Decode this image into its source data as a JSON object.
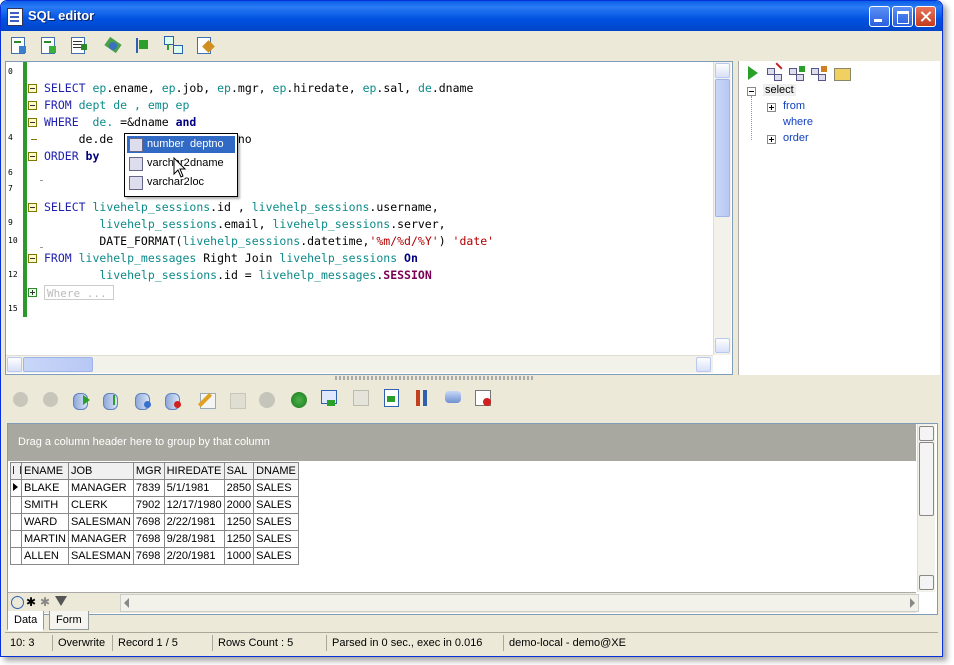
{
  "window": {
    "title": "SQL editor"
  },
  "toolbar": {
    "icons": [
      "sql-new-icon",
      "sql-open-icon",
      "sql-save-icon",
      "sql-execute-icon",
      "sql-step-icon",
      "sql-plan-icon",
      "sql-check-icon"
    ]
  },
  "editor": {
    "line_numbers": [
      "0",
      "4",
      "6",
      "7",
      "9",
      "10",
      "12",
      "15"
    ],
    "lines": [
      [
        {
          "t": "SELECT ",
          "c": "kwb"
        },
        {
          "t": "ep",
          "c": "id"
        },
        {
          "t": ".ename, ",
          "c": "plain"
        },
        {
          "t": "ep",
          "c": "id"
        },
        {
          "t": ".job, ",
          "c": "plain"
        },
        {
          "t": "ep",
          "c": "id"
        },
        {
          "t": ".mgr, ",
          "c": "plain"
        },
        {
          "t": "ep",
          "c": "id"
        },
        {
          "t": ".hiredate, ",
          "c": "plain"
        },
        {
          "t": "ep",
          "c": "id"
        },
        {
          "t": ".sal, ",
          "c": "plain"
        },
        {
          "t": "de",
          "c": "id"
        },
        {
          "t": ".dname",
          "c": "plain"
        }
      ],
      [
        {
          "t": "FROM ",
          "c": "kwb"
        },
        {
          "t": "dept de , emp ep",
          "c": "id"
        }
      ],
      [
        {
          "t": "WHERE ",
          "c": "kwb"
        },
        {
          "t": " de.",
          "c": "id"
        },
        {
          "t": " =&dname ",
          "c": "plain"
        },
        {
          "t": "and",
          "c": "kwd"
        }
      ],
      [
        {
          "t": "     de.de",
          "c": "plain"
        },
        {
          "t": "                  ",
          "c": "plain"
        },
        {
          "t": "no",
          "c": "plain"
        }
      ],
      [
        {
          "t": "ORDER ",
          "c": "kwb"
        },
        {
          "t": "by",
          "c": "kwd"
        }
      ],
      [
        {
          "t": "SELECT ",
          "c": "kwb"
        },
        {
          "t": "livehelp_sessions",
          "c": "id"
        },
        {
          "t": ".id , ",
          "c": "plain"
        },
        {
          "t": "livehelp_sessions",
          "c": "id"
        },
        {
          "t": ".username,",
          "c": "plain"
        }
      ],
      [
        {
          "t": "        livehelp_sessions",
          "c": "id"
        },
        {
          "t": ".email, ",
          "c": "plain"
        },
        {
          "t": "livehelp_sessions",
          "c": "id"
        },
        {
          "t": ".server,",
          "c": "plain"
        }
      ],
      [
        {
          "t": "        DATE_FORMAT(",
          "c": "plain"
        },
        {
          "t": "livehelp_sessions",
          "c": "id"
        },
        {
          "t": ".datetime,",
          "c": "plain"
        },
        {
          "t": "'%m/%d/%Y'",
          "c": "str"
        },
        {
          "t": ") ",
          "c": "plain"
        },
        {
          "t": "'date'",
          "c": "str"
        }
      ],
      [
        {
          "t": "FROM ",
          "c": "kwb"
        },
        {
          "t": "livehelp_messages ",
          "c": "id"
        },
        {
          "t": "Right Join ",
          "c": "plain"
        },
        {
          "t": "livehelp_sessions ",
          "c": "id"
        },
        {
          "t": "On",
          "c": "kwd"
        }
      ],
      [
        {
          "t": "        livehelp_sessions",
          "c": "id"
        },
        {
          "t": ".id = ",
          "c": "plain"
        },
        {
          "t": "livehelp_messages",
          "c": "id"
        },
        {
          "t": ".",
          "c": "plain"
        },
        {
          "t": "SESSION",
          "c": "kw"
        }
      ]
    ],
    "where_placeholder": "Where ..."
  },
  "autocomplete": [
    {
      "type": "number",
      "name": "deptno",
      "selected": true
    },
    {
      "type": "varchar2",
      "name": "dname",
      "selected": false
    },
    {
      "type": "varchar2",
      "name": "loc",
      "selected": false
    }
  ],
  "tree": {
    "root": "select",
    "children": [
      "from",
      "where",
      "order"
    ]
  },
  "grid": {
    "group_hint": "Drag a column header here to group by that column",
    "columns": [
      "ENAME",
      "JOB",
      "MGR",
      "HIREDATE",
      "SAL",
      "DNAME"
    ],
    "rows": [
      [
        "BLAKE",
        "MANAGER",
        "7839",
        "5/1/1981",
        "2850",
        "SALES"
      ],
      [
        "SMITH",
        "CLERK",
        "7902",
        "12/17/1980",
        "2000",
        "SALES"
      ],
      [
        "WARD",
        "SALESMAN",
        "7698",
        "2/22/1981",
        "1250",
        "SALES"
      ],
      [
        "MARTIN",
        "MANAGER",
        "7698",
        "9/28/1981",
        "1250",
        "SALES"
      ],
      [
        "ALLEN",
        "SALESMAN",
        "7698",
        "2/20/1981",
        "1000",
        "SALES"
      ]
    ]
  },
  "tabs": [
    "Data",
    "Form"
  ],
  "status": {
    "position": "10: 3",
    "mode": "Overwrite",
    "record": "Record  1 / 5",
    "rows": "Rows Count  : 5",
    "timing": "Parsed in 0 sec., exec in 0.016 sec.",
    "connection": "demo-local - demo@XE"
  }
}
